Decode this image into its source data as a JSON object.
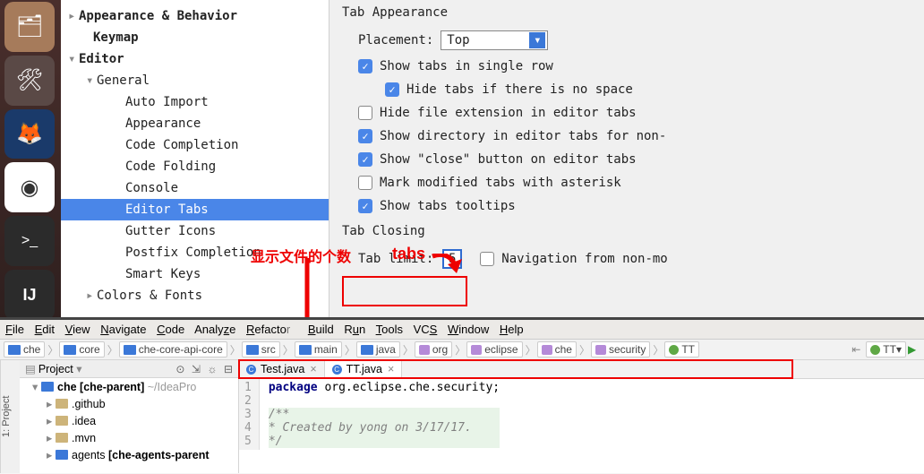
{
  "launcher": [
    {
      "name": "files",
      "icon": "🗂",
      "bg": "#a67b5b"
    },
    {
      "name": "settings",
      "icon": "🛠",
      "bg": "#5a4946"
    },
    {
      "name": "firefox",
      "icon": "🦊",
      "bg": "#1a3a6a"
    },
    {
      "name": "chrome",
      "icon": "⬤",
      "bg": "#fff"
    },
    {
      "name": "terminal",
      "icon": ">_",
      "bg": "#2b2b2b"
    },
    {
      "name": "intellij",
      "icon": "IJ",
      "bg": "#2b2b2b"
    }
  ],
  "settings": {
    "tree": {
      "appearance": "Appearance & Behavior",
      "keymap": "Keymap",
      "editor": "Editor",
      "general": "General",
      "items": [
        "Auto Import",
        "Appearance",
        "Code Completion",
        "Code Folding",
        "Console",
        "Editor Tabs",
        "Gutter Icons",
        "Postfix Completion",
        "Smart Keys"
      ],
      "colors": "Colors & Fonts"
    },
    "panel": {
      "tabAppearance": "Tab Appearance",
      "placement_label": "Placement:",
      "placement_value": "Top",
      "chk_singleRow": "Show tabs in single row",
      "chk_hideNoSpace": "Hide tabs if there is no space",
      "chk_hideExt": "Hide file extension in editor tabs",
      "chk_showDir": "Show directory in editor tabs for non-",
      "chk_closeBtn": "Show \"close\" button on editor tabs",
      "chk_markMod": "Mark modified tabs with asterisk",
      "chk_tooltips": "Show tabs tooltips",
      "tabClosing": "Tab Closing",
      "tabLimit_label": "Tab limit:",
      "tabLimit_value": "5",
      "chk_nav": "Navigation from non-mo"
    }
  },
  "annotation": {
    "text1": "显示文件的个数",
    "text2": "tabs"
  },
  "ide": {
    "menu": [
      "File",
      "Edit",
      "View",
      "Navigate",
      "Code",
      "Analyze",
      "Refactor",
      "Build",
      "Run",
      "Tools",
      "VCS",
      "Window",
      "Help"
    ],
    "crumbs": [
      "che",
      "core",
      "che-core-api-core",
      "src",
      "main",
      "java",
      "org",
      "eclipse",
      "che",
      "security",
      "TT"
    ],
    "run_config": "TT",
    "project": {
      "pane_tab": "1: Project",
      "title": "Project",
      "root": "che",
      "root_suffix": "[che-parent]",
      "root_path": "~/IdeaPro",
      "dirs": [
        ".github",
        ".idea",
        ".mvn"
      ],
      "agents": "agents",
      "agents_suffix": "[che-agents-parent"
    },
    "tabs": [
      {
        "name": "Test.java",
        "active": false
      },
      {
        "name": "TT.java",
        "active": true
      }
    ],
    "code": {
      "line1_kw": "package",
      "line1": " org.eclipse.che.security;",
      "line3": "/**",
      "line4": " * Created by yong on 3/17/17.",
      "line5": " */"
    }
  }
}
